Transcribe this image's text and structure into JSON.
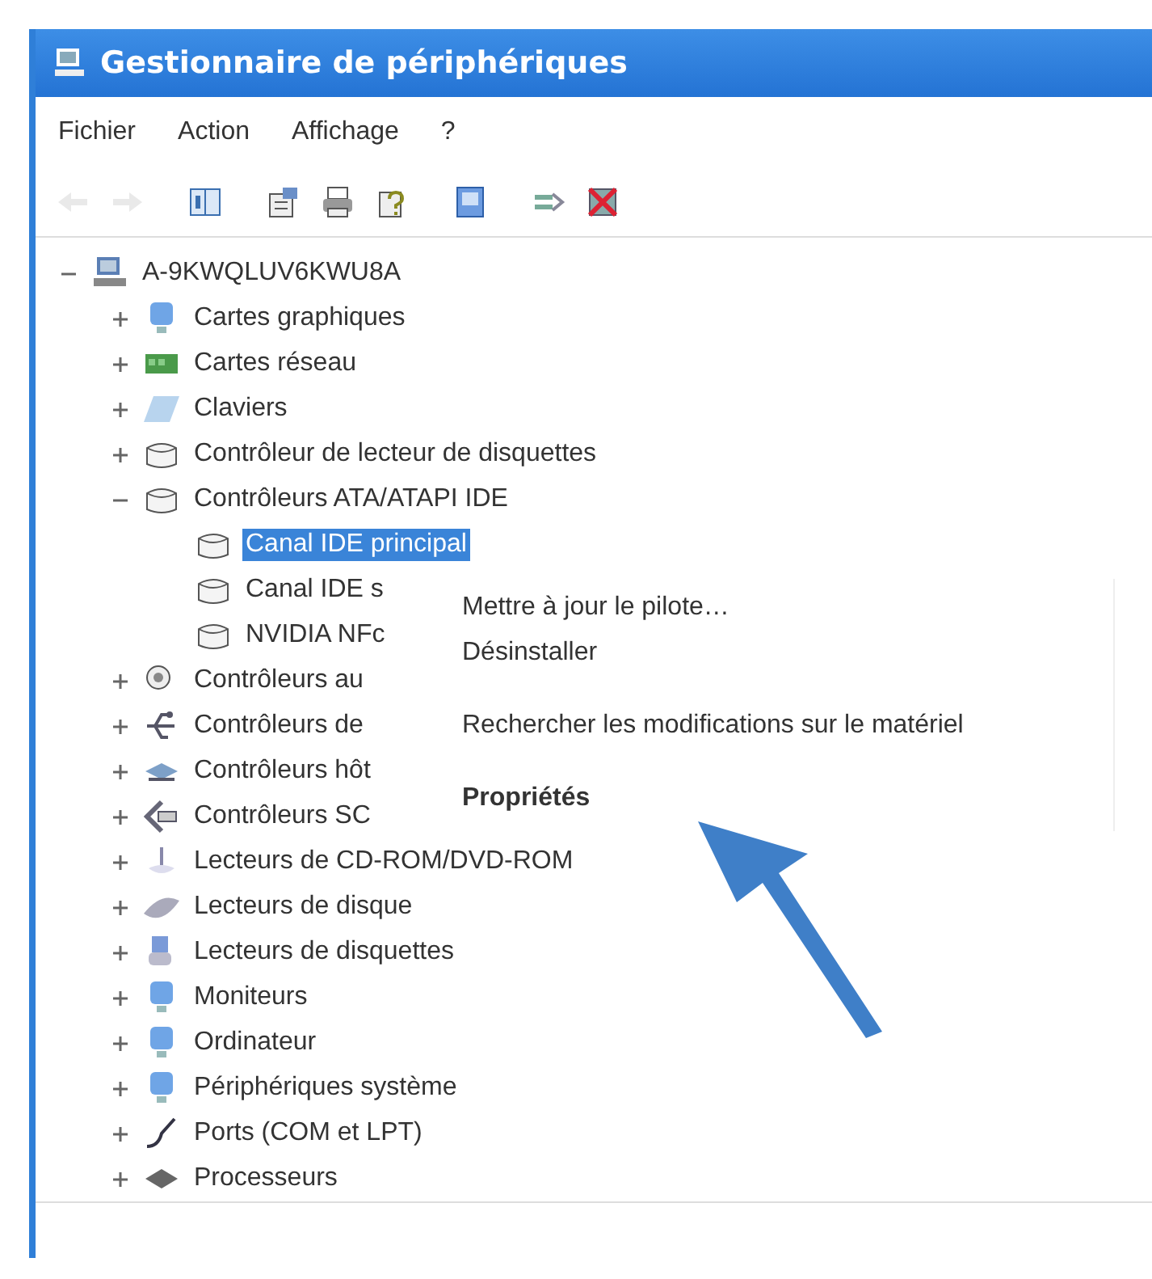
{
  "window": {
    "title": "Gestionnaire de périphériques"
  },
  "menu_bar": [
    "Fichier",
    "Action",
    "Affichage",
    "?"
  ],
  "toolbar": [
    {
      "kind": "back",
      "disabled": true
    },
    {
      "kind": "forward",
      "disabled": true
    },
    {
      "kind": "tree-toggle",
      "disabled": false
    },
    {
      "kind": "properties",
      "disabled": false
    },
    {
      "kind": "print",
      "disabled": false
    },
    {
      "kind": "help",
      "disabled": false
    },
    {
      "kind": "scan",
      "disabled": false
    },
    {
      "kind": "update",
      "disabled": false
    },
    {
      "kind": "uninstall",
      "disabled": false
    }
  ],
  "tree": {
    "label": "A-9KWQLUV6KWU8A",
    "kind": "computer",
    "expanded": true,
    "children": [
      {
        "label": "Cartes graphiques",
        "kind": "display",
        "expanded": false
      },
      {
        "label": "Cartes réseau",
        "kind": "network",
        "expanded": false
      },
      {
        "label": "Claviers",
        "kind": "keyboard",
        "expanded": false
      },
      {
        "label": "Contrôleur de lecteur de disquettes",
        "kind": "drive",
        "expanded": false
      },
      {
        "label": "Contrôleurs ATA/ATAPI IDE",
        "kind": "drive",
        "expanded": true,
        "children": [
          {
            "label": "Canal IDE principal",
            "kind": "drive",
            "selected": true
          },
          {
            "label": "Canal IDE s",
            "kind": "drive",
            "selected": false
          },
          {
            "label": "NVIDIA NFc",
            "kind": "drive",
            "selected": false
          }
        ]
      },
      {
        "label": "Contrôleurs au",
        "kind": "sound",
        "expanded": false
      },
      {
        "label": "Contrôleurs de",
        "kind": "usb",
        "expanded": false
      },
      {
        "label": "Contrôleurs hôt",
        "kind": "host",
        "expanded": false
      },
      {
        "label": "Contrôleurs SC",
        "kind": "scsi",
        "expanded": false
      },
      {
        "label": "Lecteurs de CD-ROM/DVD-ROM",
        "kind": "cdrom",
        "expanded": false
      },
      {
        "label": "Lecteurs de disque",
        "kind": "disk",
        "expanded": false
      },
      {
        "label": "Lecteurs de disquettes",
        "kind": "floppy",
        "expanded": false
      },
      {
        "label": "Moniteurs",
        "kind": "display",
        "expanded": false
      },
      {
        "label": "Ordinateur",
        "kind": "display",
        "expanded": false
      },
      {
        "label": "Périphériques système",
        "kind": "display",
        "expanded": false
      },
      {
        "label": "Ports (COM et LPT)",
        "kind": "port",
        "expanded": false
      },
      {
        "label": "Processeurs",
        "kind": "cpu",
        "expanded": false
      }
    ]
  },
  "context_menu": [
    {
      "kind": "item",
      "label": "Mettre à jour le pilote…",
      "default": false
    },
    {
      "kind": "item",
      "label": "Désinstaller",
      "default": false
    },
    {
      "kind": "separator"
    },
    {
      "kind": "item",
      "label": "Rechercher les modifications sur le matériel",
      "default": false
    },
    {
      "kind": "separator"
    },
    {
      "kind": "item",
      "label": "Propriétés",
      "default": true
    }
  ]
}
